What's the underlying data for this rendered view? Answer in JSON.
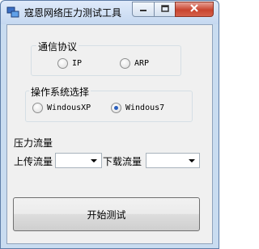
{
  "window": {
    "title": "寇恩网络压力测试工具"
  },
  "protocol_group": {
    "label": "通信协议",
    "options": [
      {
        "label": "IP",
        "checked": false
      },
      {
        "label": "ARP",
        "checked": false
      }
    ]
  },
  "os_group": {
    "label": "操作系统选择",
    "options": [
      {
        "label": "WindousXP",
        "checked": false
      },
      {
        "label": "Windous7",
        "checked": true
      }
    ]
  },
  "traffic": {
    "label": "压力流量",
    "upload_label": "上传流量",
    "upload_value": "",
    "download_label": "下载流量",
    "download_value": ""
  },
  "actions": {
    "start_label": "开始测试"
  },
  "icons": {
    "app": "network-app-icon",
    "minimize": "minimize-icon",
    "maximize": "maximize-icon",
    "close": "close-icon"
  },
  "colors": {
    "frame": "#c9dcf0",
    "close_button": "#c8442f",
    "radio_dot": "#2a5fbd"
  }
}
